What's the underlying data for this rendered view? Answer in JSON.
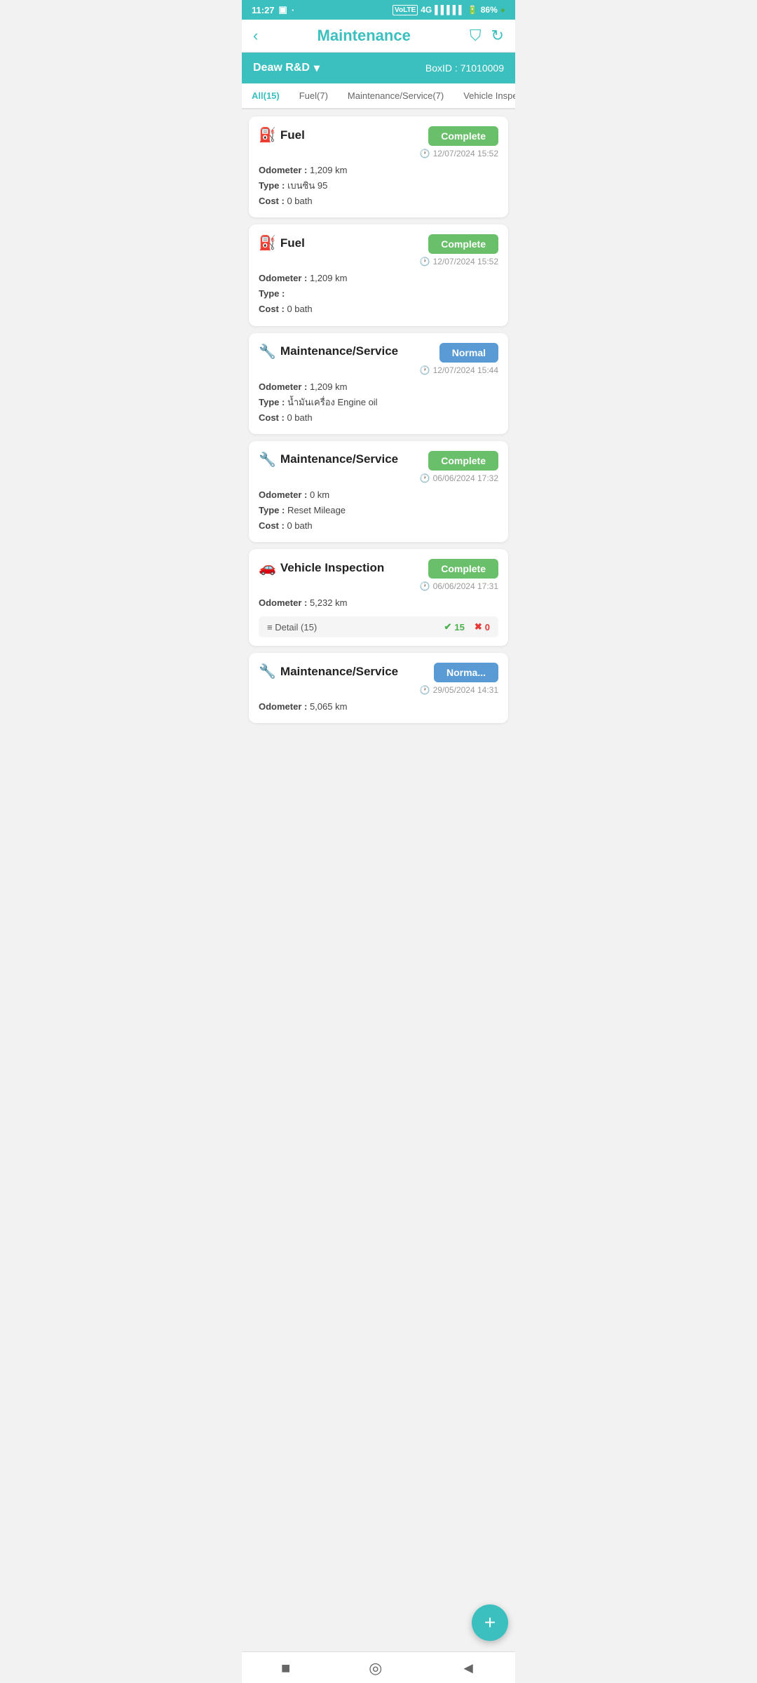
{
  "statusBar": {
    "time": "11:27",
    "battery": "86%"
  },
  "header": {
    "title": "Maintenance",
    "backIcon": "‹",
    "filterIcon": "⛉",
    "refreshIcon": "↻"
  },
  "band": {
    "company": "Deaw R&D",
    "dropdownIcon": "▾",
    "boxLabel": "BoxID : 71010009"
  },
  "tabs": [
    {
      "label": "All(15)",
      "active": true
    },
    {
      "label": "Fuel(7)",
      "active": false
    },
    {
      "label": "Maintenance/Service(7)",
      "active": false
    },
    {
      "label": "Vehicle Inspection(",
      "active": false
    }
  ],
  "cards": [
    {
      "type": "fuel",
      "title": "Fuel",
      "status": "Complete",
      "statusType": "complete",
      "odometer": "1,209 km",
      "type_label": "เบนซิน 95",
      "cost": "0 bath",
      "date": "12/07/2024 15:52"
    },
    {
      "type": "fuel",
      "title": "Fuel",
      "status": "Complete",
      "statusType": "complete",
      "odometer": "1,209 km",
      "type_label": "",
      "cost": "0 bath",
      "date": "12/07/2024 15:52"
    },
    {
      "type": "maintenance",
      "title": "Maintenance/Service",
      "status": "Normal",
      "statusType": "normal",
      "odometer": "1,209 km",
      "type_label": "น้ำมันเครื่อง Engine oil",
      "cost": "0 bath",
      "date": "12/07/2024 15:44"
    },
    {
      "type": "maintenance",
      "title": "Maintenance/Service",
      "status": "Complete",
      "statusType": "complete",
      "odometer": "0 km",
      "type_label": "Reset Mileage",
      "cost": "0 bath",
      "date": "06/06/2024 17:32"
    },
    {
      "type": "vehicle",
      "title": "Vehicle Inspection",
      "status": "Complete",
      "statusType": "complete",
      "odometer": "5,232 km",
      "date": "06/06/2024 17:31",
      "detail": {
        "label": "Detail (15)",
        "checkCount": 15,
        "crossCount": 0
      }
    },
    {
      "type": "maintenance",
      "title": "Maintenance/Service",
      "status": "Norma...",
      "statusType": "normal",
      "odometer": "5,065 km",
      "type_label": "",
      "cost": "",
      "date": "29/05/2024 14:31"
    }
  ],
  "fab": "+",
  "bottomNav": {
    "icons": [
      "■",
      "◎",
      "◄"
    ]
  }
}
